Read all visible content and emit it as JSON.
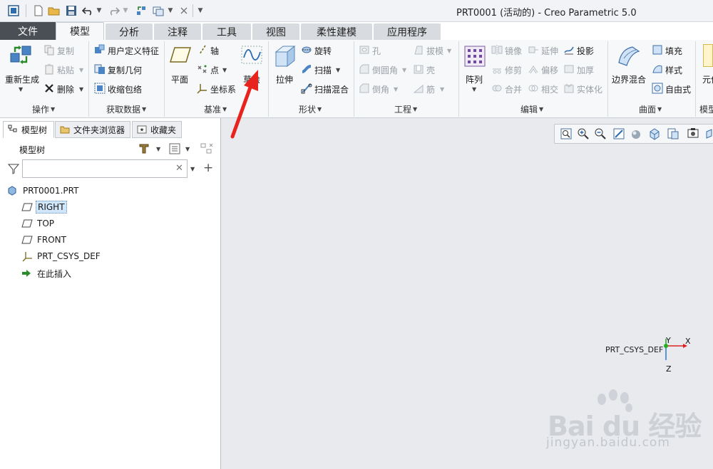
{
  "window": {
    "title": "PRT0001 (活动的) - Creo Parametric 5.0"
  },
  "menu_tabs": [
    {
      "label": "文件"
    },
    {
      "label": "模型"
    },
    {
      "label": "分析"
    },
    {
      "label": "注释"
    },
    {
      "label": "工具"
    },
    {
      "label": "视图"
    },
    {
      "label": "柔性建模"
    },
    {
      "label": "应用程序"
    }
  ],
  "ribbon": {
    "operations": {
      "regenerate": "重新生成",
      "copy": "复制",
      "paste": "粘贴",
      "delete": "删除",
      "group": "操作"
    },
    "get_data": {
      "user_defined_feature": "用户定义特征",
      "copy_geometry": "复制几何",
      "shrinkwrap": "收缩包络",
      "group": "获取数据"
    },
    "datum": {
      "plane": "平面",
      "axis": "轴",
      "point": "点",
      "csys": "坐标系",
      "sketch": "草绘",
      "group": "基准"
    },
    "shapes": {
      "extrude": "拉伸",
      "revolve": "旋转",
      "sweep": "扫描",
      "swept_blend": "扫描混合",
      "group": "形状"
    },
    "engineering": {
      "hole": "孔",
      "draft": "拔模",
      "round": "倒圆角",
      "shell": "壳",
      "chamfer": "倒角",
      "rib": "筋",
      "group": "工程"
    },
    "editing": {
      "pattern": "阵列",
      "mirror": "镜像",
      "extend": "延伸",
      "project": "投影",
      "trim": "修剪",
      "offset": "偏移",
      "thicken": "加厚",
      "merge": "合并",
      "intersect": "相交",
      "solidify": "实体化",
      "group": "编辑"
    },
    "surfaces": {
      "boundary_blend": "边界混合",
      "fill": "填充",
      "style": "样式",
      "freestyle": "自由式",
      "group": "曲面"
    },
    "model_intent": {
      "component_cut": "元件",
      "group_cut": "模型"
    }
  },
  "left_panel": {
    "tabs": [
      {
        "label": "模型树"
      },
      {
        "label": "文件夹浏览器"
      },
      {
        "label": "收藏夹"
      }
    ],
    "tree_header": "模型树",
    "filter_placeholder": "",
    "tree": [
      {
        "label": "PRT0001.PRT",
        "icon": "part-icon"
      },
      {
        "label": "RIGHT",
        "icon": "datum-plane-icon",
        "selected": true
      },
      {
        "label": "TOP",
        "icon": "datum-plane-icon"
      },
      {
        "label": "FRONT",
        "icon": "datum-plane-icon"
      },
      {
        "label": "PRT_CSYS_DEF",
        "icon": "csys-icon"
      },
      {
        "label": "在此插入",
        "icon": "insert-arrow-icon"
      }
    ]
  },
  "graphics": {
    "csys_label": "PRT_CSYS_DEF",
    "axis_y": "Y",
    "axis_x": "X",
    "axis_z": "Z"
  },
  "watermark": {
    "brand": "Bai du 经验",
    "url": "jingyan.baidu.com"
  },
  "colors": {
    "file_tab": "#4a4f55",
    "annotation_arrow": "#e8231e",
    "selection": "#cfe6fb"
  }
}
